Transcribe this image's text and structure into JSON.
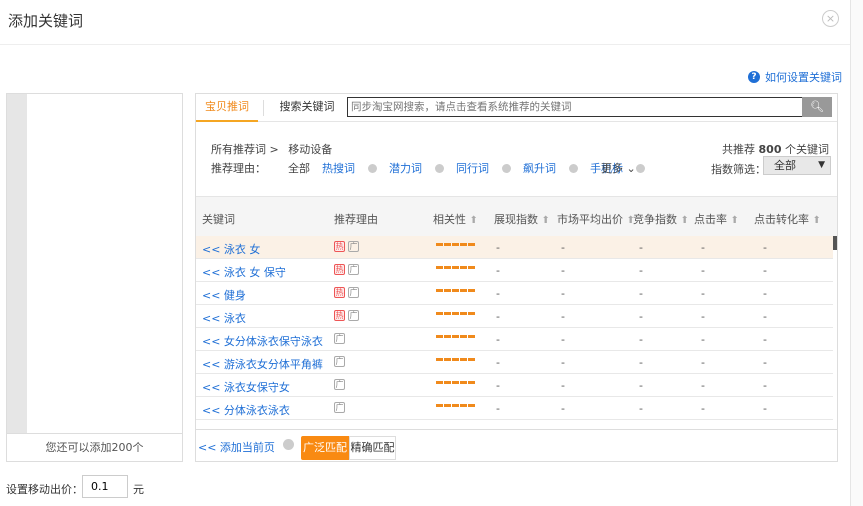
{
  "dialog": {
    "title": "添加关键词",
    "close": "×"
  },
  "help": {
    "icon": "question-circle-icon",
    "label": "如何设置关键词"
  },
  "left_panel": {
    "footer": "您还可以添加200个"
  },
  "tabs": [
    "宝贝推词",
    "搜索关键词"
  ],
  "search": {
    "placeholder": "同步淘宝网搜索，请点击查看系统推荐的关键词",
    "icon": "search-icon"
  },
  "breadcrumb": {
    "root": "所有推荐词 >",
    "current": "移动设备"
  },
  "total": {
    "prefix": "共推荐",
    "count": "800",
    "suffix": "个关键词"
  },
  "filter": {
    "label": "推荐理由：",
    "items": [
      "全部",
      "热搜词",
      "潜力词",
      "同行词",
      "飙升词",
      "手机标"
    ],
    "more": "更多 ⌄"
  },
  "index_filter": {
    "label": "指数筛选：",
    "value": "全部"
  },
  "columns": [
    "关键词",
    "推荐理由",
    "相关性",
    "展现指数",
    "市场平均出价",
    "竞争指数",
    "点击率",
    "点击转化率"
  ],
  "rows": [
    {
      "keyword": "<< 泳衣 女",
      "hot": true,
      "relevance": 5
    },
    {
      "keyword": "<< 泳衣 女 保守",
      "hot": true,
      "relevance": 5
    },
    {
      "keyword": "<< 健身",
      "hot": true,
      "relevance": 5
    },
    {
      "keyword": "<< 泳衣",
      "hot": true,
      "relevance": 5
    },
    {
      "keyword": "<< 女分体泳衣保守泳衣",
      "hot": false,
      "relevance": 5
    },
    {
      "keyword": "<< 游泳衣女分体平角裤",
      "hot": false,
      "relevance": 5
    },
    {
      "keyword": "<< 泳衣女保守女",
      "hot": false,
      "relevance": 5
    },
    {
      "keyword": "<< 分体泳衣泳衣",
      "hot": false,
      "relevance": 5
    }
  ],
  "row_values": "-",
  "tag_labels": {
    "hot": "热",
    "broad": "广"
  },
  "footer": {
    "add_page": "<<  添加当前页",
    "broad": "广泛匹配",
    "exact": "精确匹配"
  },
  "bid": {
    "label": "设置移动出价：",
    "value": "0.1",
    "unit": "元"
  },
  "colors": {
    "accent": "#f98a12",
    "link": "#1f6fd6"
  }
}
